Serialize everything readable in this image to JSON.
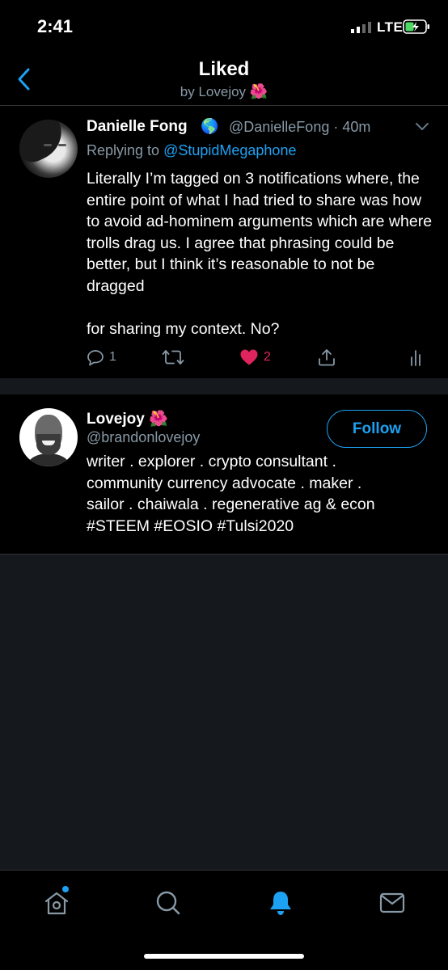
{
  "status_bar": {
    "time": "2:41",
    "network": "LTE"
  },
  "header": {
    "title": "Liked",
    "subtitle": "by Lovejoy",
    "subtitle_emoji": "🌺"
  },
  "tweet": {
    "author_name": "Danielle Fong",
    "author_emoji": "🌎",
    "handle_time": "@DanielleFong · 40m",
    "replying_prefix": "Replying to",
    "replying_handle": "@StupidMegaphone",
    "text": "Literally I’m tagged on 3 notifications where, the entire point of what I had tried to share was how to avoid ad-hominem arguments which are where trolls drag us. I agree that phrasing could be better, but I think it’s reasonable to not be dragged\n\nfor sharing my context. No?",
    "reply_count": "1",
    "retweet_count": "",
    "like_count": "2",
    "like_color": "#e0245e"
  },
  "user_card": {
    "name": "Lovejoy",
    "name_emoji": "🌺",
    "handle": "@brandonlovejoy",
    "follow_label": "Follow",
    "bio": "writer . explorer . crypto consultant .\ncommunity currency advocate . maker .\nsailor . chaiwala . regenerative ag & econ\n#STEEM #EOSIO #Tulsi2020"
  },
  "tab_bar": {
    "tabs": [
      {
        "name": "home",
        "icon": "home-icon",
        "active": false,
        "has_dot": true
      },
      {
        "name": "search",
        "icon": "search-icon",
        "active": false
      },
      {
        "name": "notifications",
        "icon": "bell-icon",
        "active": true
      },
      {
        "name": "messages",
        "icon": "mail-icon",
        "active": false
      }
    ],
    "accent": "#1da1f2"
  },
  "colors": {
    "accent": "#1da1f2",
    "secondary_text": "#8899a6",
    "background": "#000000"
  }
}
